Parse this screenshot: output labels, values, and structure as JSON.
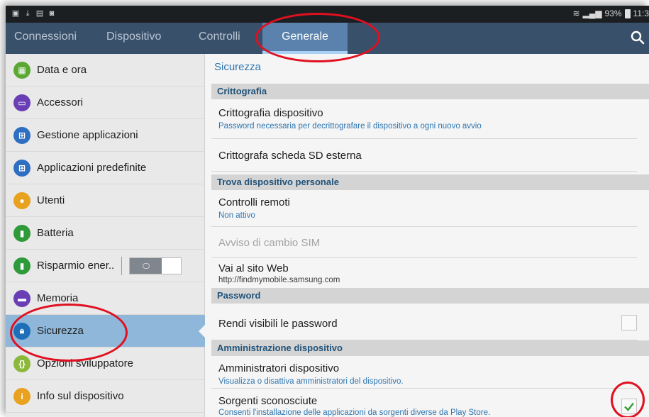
{
  "status_bar": {
    "signal_battery": "93%",
    "time": "11:3"
  },
  "tabs": [
    {
      "label": "Connessioni"
    },
    {
      "label": "Dispositivo"
    },
    {
      "label": "Controlli"
    },
    {
      "label": "Generale"
    }
  ],
  "sidebar": {
    "items": [
      {
        "label": "Data e ora",
        "color": "#5aa832"
      },
      {
        "label": "Accessori",
        "color": "#6a3fb5"
      },
      {
        "label": "Gestione applicazioni",
        "color": "#2f6fc1"
      },
      {
        "label": "Applicazioni predefinite",
        "color": "#2f6fc1"
      },
      {
        "label": "Utenti",
        "color": "#e8a21f"
      },
      {
        "label": "Batteria",
        "color": "#2e9a3a"
      },
      {
        "label": "Risparmio ener..",
        "color": "#2e9a3a"
      },
      {
        "label": "Memoria",
        "color": "#6a3fb5"
      },
      {
        "label": "Sicurezza",
        "color": "#1f6fb8"
      },
      {
        "label": "Opzioni sviluppatore",
        "color": "#8cb83a"
      },
      {
        "label": "Info sul dispositivo",
        "color": "#e8a21f"
      }
    ]
  },
  "main": {
    "title": "Sicurezza",
    "sections": [
      {
        "label": "Crittografia"
      },
      {
        "label": "Trova dispositivo personale"
      },
      {
        "label": "Password"
      },
      {
        "label": "Amministrazione dispositivo"
      }
    ],
    "rows": [
      {
        "title": "Crittografia dispositivo",
        "subtitle": "Password necessaria per decrittografare il dispositivo a ogni nuovo avvio"
      },
      {
        "title": "Crittografa scheda SD esterna"
      },
      {
        "title": "Controlli remoti",
        "subtitle": "Non attivo"
      },
      {
        "title": "Avviso di cambio SIM"
      },
      {
        "title": "Vai al sito Web",
        "subtitle": "http://findmymobile.samsung.com"
      },
      {
        "title": "Rendi visibili le password",
        "checked": false
      },
      {
        "title": "Amministratori dispositivo",
        "subtitle": "Visualizza o disattiva amministratori del dispositivo."
      },
      {
        "title": "Sorgenti sconosciute",
        "subtitle": "Consenti l'installazione delle applicazioni da sorgenti diverse da Play Store.",
        "checked": true
      }
    ]
  },
  "colors": {
    "accent": "#5a82ac",
    "annotation": "#e01020",
    "checkmark": "#3aa43a"
  }
}
